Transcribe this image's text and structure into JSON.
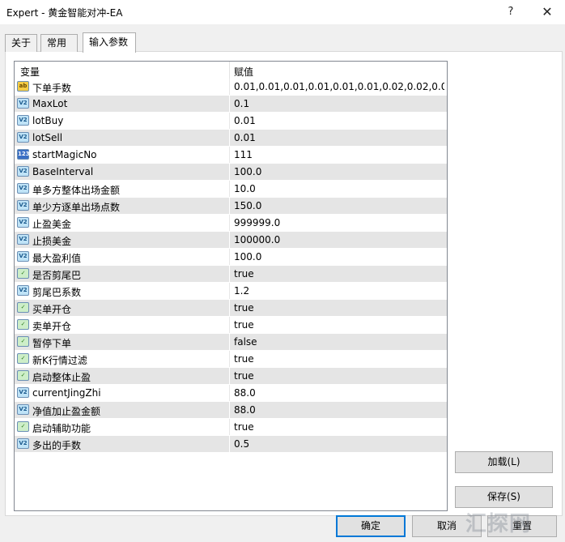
{
  "window": {
    "title": "Expert - 黄金智能对冲-EA",
    "help_label": "?",
    "close_label": "✕"
  },
  "tabs": [
    {
      "label": "关于",
      "active": false
    },
    {
      "label": "常用",
      "active": false
    },
    {
      "label": "输入参数",
      "active": true
    }
  ],
  "grid": {
    "header": {
      "variable": "变量",
      "value": "赋值"
    },
    "rows": [
      {
        "icon": "string-icon",
        "icon_text": "ab",
        "name": "下单手数",
        "value": "0.01,0.01,0.01,0.01,0.01,0.01,0.02,0.02,0.02,0..."
      },
      {
        "icon": "double-icon",
        "icon_text": "V2",
        "name": "MaxLot",
        "value": "0.1"
      },
      {
        "icon": "double-icon",
        "icon_text": "V2",
        "name": "lotBuy",
        "value": "0.01"
      },
      {
        "icon": "double-icon",
        "icon_text": "V2",
        "name": "lotSell",
        "value": "0.01"
      },
      {
        "icon": "integer-icon",
        "icon_text": "123",
        "name": "startMagicNo",
        "value": "111"
      },
      {
        "icon": "double-icon",
        "icon_text": "V2",
        "name": "BaseInterval",
        "value": "100.0"
      },
      {
        "icon": "double-icon",
        "icon_text": "V2",
        "name": "单多方整体出场金额",
        "value": "10.0"
      },
      {
        "icon": "double-icon",
        "icon_text": "V2",
        "name": "单少方逐单出场点数",
        "value": "150.0"
      },
      {
        "icon": "double-icon",
        "icon_text": "V2",
        "name": "止盈美金",
        "value": "999999.0"
      },
      {
        "icon": "double-icon",
        "icon_text": "V2",
        "name": "止损美金",
        "value": "100000.0"
      },
      {
        "icon": "double-icon",
        "icon_text": "V2",
        "name": "最大盈利值",
        "value": "100.0"
      },
      {
        "icon": "bool-icon",
        "icon_text": "✓",
        "name": "是否剪尾巴",
        "value": "true"
      },
      {
        "icon": "double-icon",
        "icon_text": "V2",
        "name": "剪尾巴系数",
        "value": "1.2"
      },
      {
        "icon": "bool-icon",
        "icon_text": "✓",
        "name": "买单开仓",
        "value": "true"
      },
      {
        "icon": "bool-icon",
        "icon_text": "✓",
        "name": "卖单开仓",
        "value": "true"
      },
      {
        "icon": "bool-icon",
        "icon_text": "✓",
        "name": "暂停下单",
        "value": "false"
      },
      {
        "icon": "bool-icon",
        "icon_text": "✓",
        "name": "新K行情过滤",
        "value": "true"
      },
      {
        "icon": "bool-icon",
        "icon_text": "✓",
        "name": "启动整体止盈",
        "value": "true"
      },
      {
        "icon": "double-icon",
        "icon_text": "V2",
        "name": "currentJingZhi",
        "value": "88.0"
      },
      {
        "icon": "double-icon",
        "icon_text": "V2",
        "name": "净值加止盈金额",
        "value": "88.0"
      },
      {
        "icon": "bool-icon",
        "icon_text": "✓",
        "name": "启动辅助功能",
        "value": "true"
      },
      {
        "icon": "double-icon",
        "icon_text": "V2",
        "name": "多出的手数",
        "value": "0.5"
      }
    ]
  },
  "buttons": {
    "load": "加载(L)",
    "save": "保存(S)",
    "ok": "确定",
    "cancel": "取消",
    "reset": "重置"
  },
  "watermark": "汇探网"
}
